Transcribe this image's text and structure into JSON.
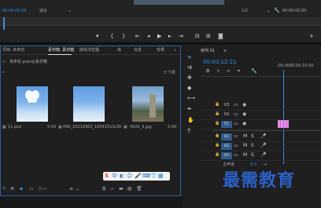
{
  "source_monitor": {
    "timecode_left": "00:00:00:00",
    "fit_label": "适合",
    "scale_label": "1/2",
    "timecode_right": "00:00:00:00"
  },
  "project_panel": {
    "tabs": [
      "项目: 未命名",
      "素材箱: 素材箱",
      "媒体浏览器",
      "库",
      "信息",
      "效果"
    ],
    "path": "未命名.prproj\\素材箱",
    "item_count": "3 个项",
    "items": [
      {
        "name": "11.psd",
        "duration": "5:00"
      },
      {
        "name": "IMG_20210903_1654151...",
        "duration": "5:00"
      },
      {
        "name": "0924_3.jpg",
        "duration": "5:00"
      }
    ]
  },
  "sequence_panel": {
    "tab": "序列 01",
    "timecode": "00:00:12:21",
    "ruler_left": ":00:00",
    "ruler_right": "00:00:15:00",
    "video_tracks": [
      "V3",
      "V2",
      "V1"
    ],
    "audio_tracks": [
      "A1",
      "A2",
      "A3"
    ],
    "master_label": "主声道",
    "master_value": "0.0",
    "track_letters": {
      "mute": "M",
      "solo": "S"
    }
  },
  "ime": {
    "brand": "S",
    "mode": "中"
  },
  "watermark": "最需教育",
  "colors": {
    "accent": "#2d8ceb",
    "clip": "#e28ce6",
    "watermark": "#2b61c9"
  }
}
